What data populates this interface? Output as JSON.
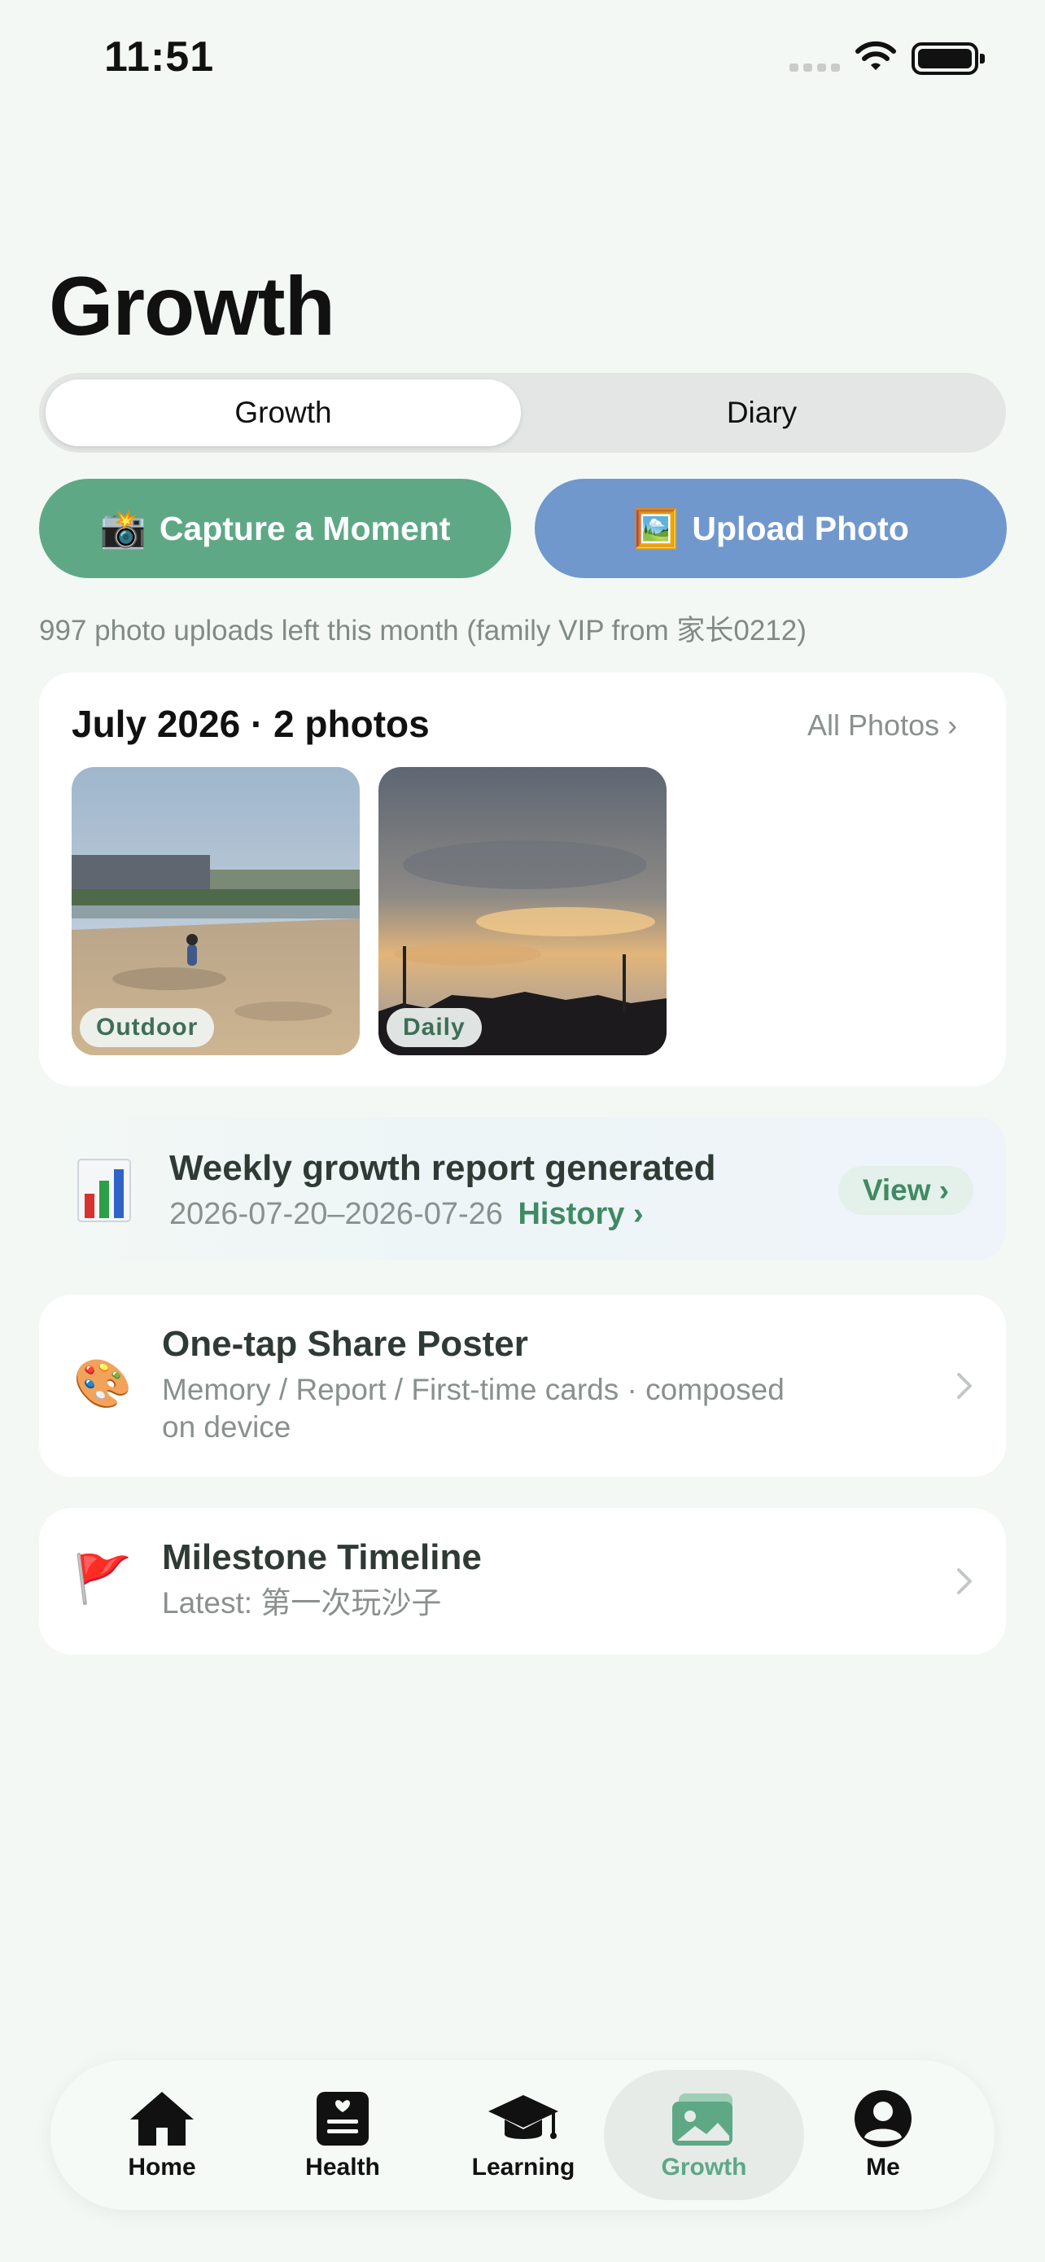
{
  "status_bar": {
    "time": "11:51"
  },
  "page": {
    "title": "Growth"
  },
  "segmented": {
    "growth": "Growth",
    "diary": "Diary",
    "selected": "Growth"
  },
  "actions": {
    "capture": {
      "emoji": "📸",
      "label": "Capture a Moment",
      "color": "#5ea886"
    },
    "upload": {
      "emoji": "🖼️",
      "label": "Upload Photo",
      "color": "#7098cd"
    }
  },
  "quota_text": "997 photo uploads left this month (family VIP from 家长0212)",
  "photos": {
    "heading": "July 2026 · 2 photos",
    "all_link": "All Photos ›",
    "items": [
      {
        "tag": "Outdoor",
        "icon": "outdoor-photo"
      },
      {
        "tag": "Daily",
        "icon": "sunset-photo"
      }
    ]
  },
  "report": {
    "icon": "bar-chart-icon",
    "title": "Weekly growth report generated",
    "dates": "2026-07-20–2026-07-26",
    "history": "History ›",
    "view": "View ›"
  },
  "poster": {
    "emoji": "🎨",
    "title": "One-tap Share Poster",
    "subtitle_line1": "Memory / Report / First-time cards · composed",
    "subtitle_line2": "on device"
  },
  "milestone": {
    "emoji": "🚩",
    "title": "Milestone Timeline",
    "subtitle": "Latest: 第一次玩沙子"
  },
  "tabbar": {
    "active_color": "#5ea886",
    "items": [
      {
        "label": "Home",
        "icon": "house-icon"
      },
      {
        "label": "Health",
        "icon": "health-icon"
      },
      {
        "label": "Learning",
        "icon": "graduation-cap-icon"
      },
      {
        "label": "Growth",
        "icon": "photos-icon"
      },
      {
        "label": "Me",
        "icon": "person-icon"
      }
    ],
    "selected": "Growth"
  }
}
